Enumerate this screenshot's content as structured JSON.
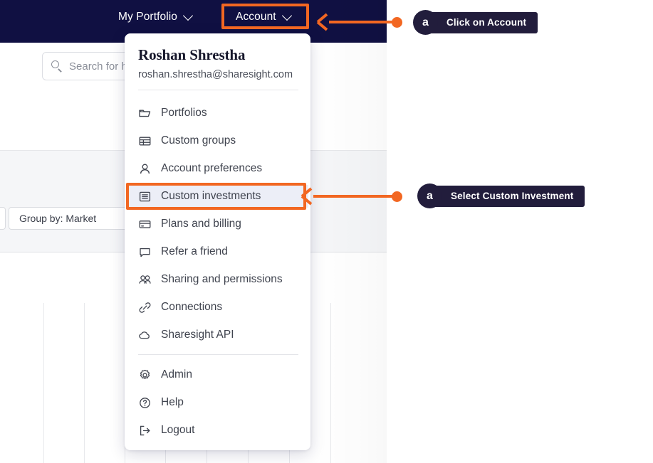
{
  "navbar": {
    "my_portfolio": "My Portfolio",
    "account": "Account",
    "chevron_icon": "chevron-down-icon",
    "background_color": "#101042"
  },
  "search": {
    "placeholder": "Search for h",
    "icon": "search-icon"
  },
  "toolbar": {
    "group_by_chip": "Group by: Market"
  },
  "account_menu": {
    "user_name": "Roshan Shrestha",
    "user_email": "roshan.shrestha@sharesight.com",
    "items": [
      {
        "label": "Portfolios",
        "icon": "folder-icon",
        "active": false
      },
      {
        "label": "Custom groups",
        "icon": "table-icon",
        "active": false
      },
      {
        "label": "Account preferences",
        "icon": "person-icon",
        "active": false
      },
      {
        "label": "Custom investments",
        "icon": "list-box-icon",
        "active": true
      },
      {
        "label": "Plans and billing",
        "icon": "credit-card-icon",
        "active": false
      },
      {
        "label": "Refer a friend",
        "icon": "chat-icon",
        "active": false
      },
      {
        "label": "Sharing and permissions",
        "icon": "people-icon",
        "active": false
      },
      {
        "label": "Connections",
        "icon": "link-icon",
        "active": false
      },
      {
        "label": "Sharesight API",
        "icon": "cloud-icon",
        "active": false
      },
      {
        "label": "Admin",
        "icon": "gear-icon",
        "active": false
      },
      {
        "label": "Help",
        "icon": "question-icon",
        "active": false
      },
      {
        "label": "Logout",
        "icon": "logout-icon",
        "active": false
      }
    ]
  },
  "annotations": {
    "accent_color": "#f26722",
    "callouts": [
      {
        "badge": "a",
        "text": "Click on Account"
      },
      {
        "badge": "a",
        "text": "Select Custom Investment"
      }
    ]
  }
}
